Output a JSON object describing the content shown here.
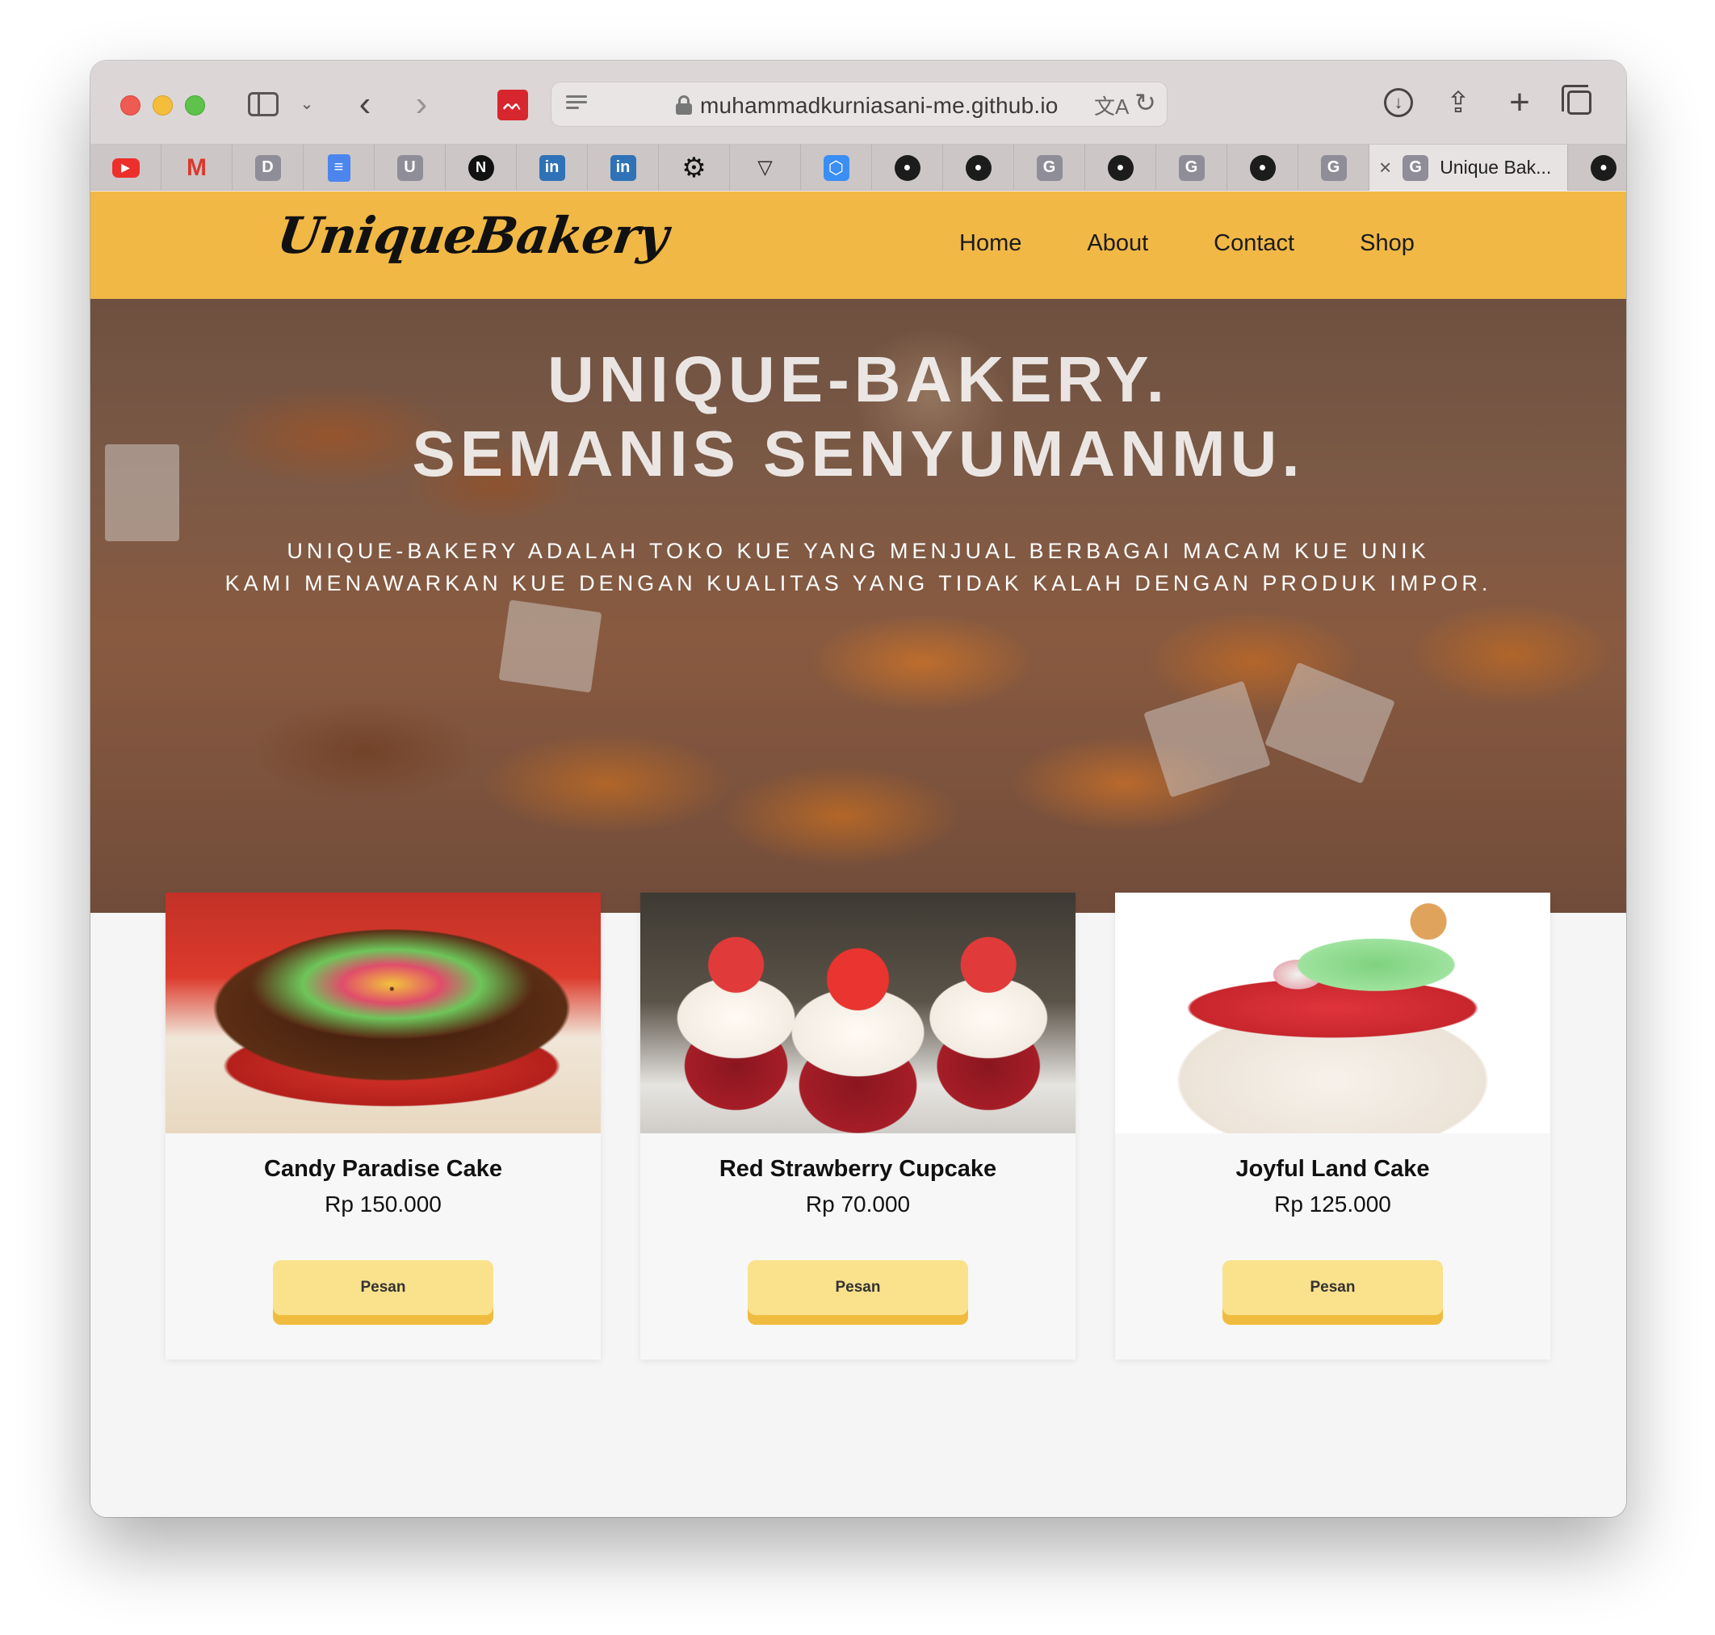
{
  "browser": {
    "url": "muhammadkurniasani-me.github.io",
    "active_tab_title": "Unique Bak...",
    "tab_favicons": [
      "youtube-icon",
      "gmail-icon",
      "d-icon",
      "docs-icon",
      "u-icon",
      "next-icon",
      "linkedin-icon",
      "linkedin-icon",
      "gear-icon",
      "vue-icon",
      "cube-icon",
      "github-icon",
      "github-icon",
      "g-icon",
      "github-icon",
      "g-icon",
      "github-icon",
      "g-icon",
      "g-icon",
      "github-icon"
    ],
    "tab_letters": {
      "d": "D",
      "u": "U",
      "g": "G",
      "next": "N",
      "linkedin": "in"
    }
  },
  "site": {
    "logo": "UniqueBakery",
    "nav": [
      "Home",
      "About",
      "Contact",
      "Shop"
    ],
    "accent_color": "#f1b846"
  },
  "hero": {
    "title_line1": "UNIQUE-BAKERY.",
    "title_line2": "SEMANIS SENYUMANMU.",
    "subtitle_line1": "UNIQUE-BAKERY ADALAH TOKO KUE YANG MENJUAL BERBAGAI MACAM KUE UNIK",
    "subtitle_line2": "KAMI MENAWARKAN KUE DENGAN KUALITAS YANG TIDAK KALAH DENGAN PRODUK IMPOR."
  },
  "products": [
    {
      "name": "Candy Paradise Cake",
      "price": "Rp 150.000",
      "button": "Pesan"
    },
    {
      "name": "Red Strawberry Cupcake",
      "price": "Rp 70.000",
      "button": "Pesan"
    },
    {
      "name": "Joyful Land Cake",
      "price": "Rp 125.000",
      "button": "Pesan"
    }
  ]
}
